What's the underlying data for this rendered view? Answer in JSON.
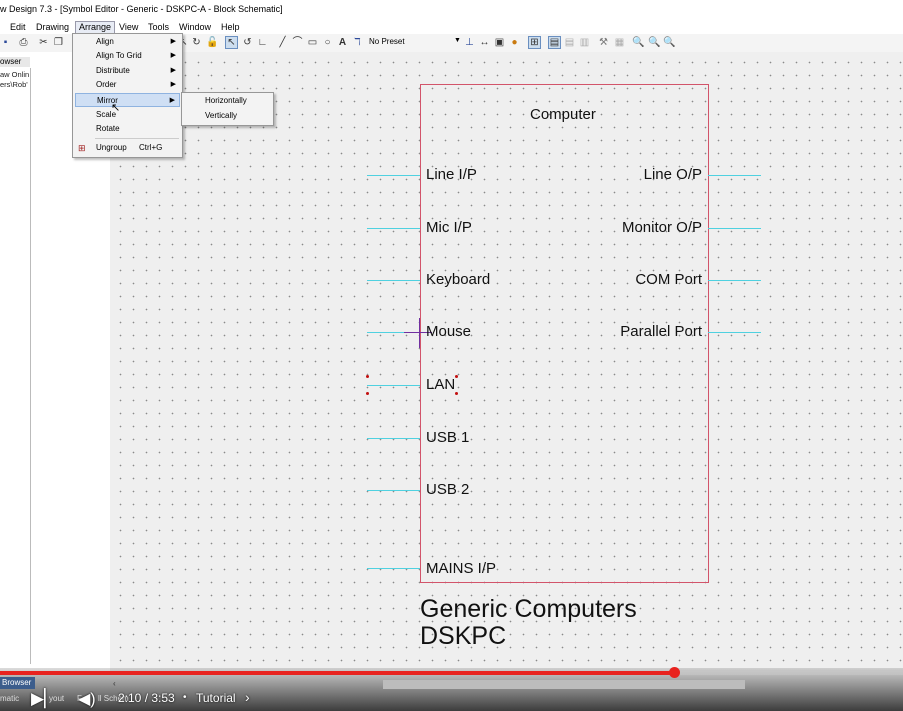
{
  "window": {
    "title": "w Design 7.3 - [Symbol Editor - Generic - DSKPC-A - Block Schematic]"
  },
  "menubar": {
    "items": [
      "Edit",
      "Drawing",
      "Arrange",
      "View",
      "Tools",
      "Window",
      "Help"
    ]
  },
  "toolbar": {
    "preset": "No Preset"
  },
  "left_panel": {
    "header": "owser",
    "lines": [
      "aw Onlin",
      "ers\\Rob'"
    ],
    "bottom_tab": "Browser",
    "bottom_lines": [
      "matic",
      "F",
      "yout"
    ]
  },
  "arrange_menu": {
    "items": [
      {
        "label": "Align",
        "submenu": true
      },
      {
        "label": "Align To Grid",
        "submenu": true
      },
      {
        "label": "Distribute",
        "submenu": true
      },
      {
        "label": "Order",
        "submenu": true
      },
      {
        "label": "Mirror",
        "submenu": true
      },
      {
        "label": "Scale",
        "submenu": false
      },
      {
        "label": "Rotate",
        "submenu": false
      },
      {
        "label": "Ungroup",
        "shortcut": "Ctrl+G",
        "submenu": false
      }
    ]
  },
  "mirror_submenu": {
    "items": [
      "Horizontally",
      "Vertically"
    ]
  },
  "symbol": {
    "title": "Computer",
    "left_pins": [
      "Line I/P",
      "Mic I/P",
      "Keyboard",
      "Mouse",
      "LAN",
      "USB 1",
      "USB 2",
      "MAINS I/P"
    ],
    "right_pins": [
      "Line O/P",
      "Monitor O/P",
      "COM Port",
      "Parallel Port"
    ],
    "ref_line1": "Generic Computers",
    "ref_line2": "DSKPC"
  },
  "video": {
    "time": "2:10 / 3:53",
    "chapter": "Tutorial",
    "chapter_chevron": "›",
    "progress": 0.746,
    "overlay_text": "ll Schem"
  },
  "colors": {
    "pin": "#4fd1e0",
    "box_border": "#d2546a",
    "progress": "#e8231f",
    "highlight": "#cfdff4"
  },
  "icons": [
    "save-icon",
    "print-icon",
    "cut-icon",
    "copy-icon",
    "select-arrow-icon",
    "line-icon",
    "rectangle-icon",
    "circle-icon",
    "text-icon",
    "zoom-in-icon",
    "zoom-out-icon",
    "play-icon",
    "volume-icon"
  ]
}
